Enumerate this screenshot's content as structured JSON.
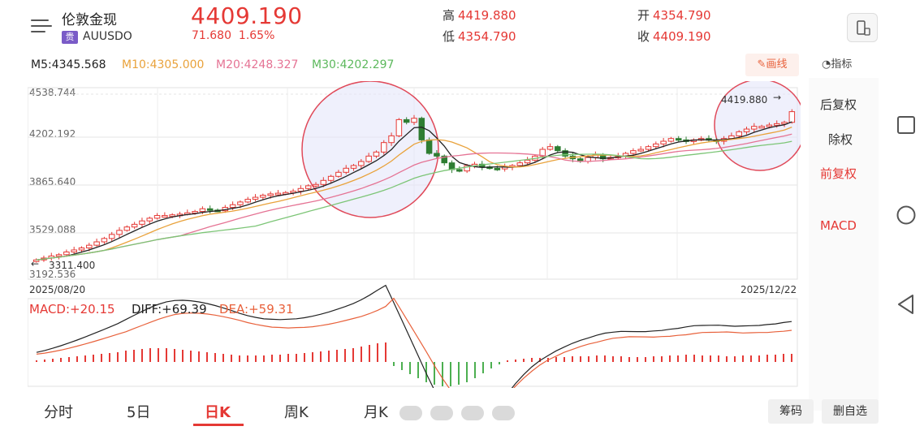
{
  "header": {
    "title": "伦敦金现",
    "badge": "贵",
    "code": "AUUSDO",
    "price": "4409.190",
    "change": "71.680",
    "change_pct": "1.65%",
    "high_label": "高",
    "high": "4419.880",
    "low_label": "低",
    "low": "4354.790",
    "open_label": "开",
    "open": "4354.790",
    "close_label": "收",
    "close": "4409.190"
  },
  "ma": {
    "m5": "M5:4345.568",
    "m10": "M10:4305.000",
    "m20": "M20:4248.327",
    "m30": "M30:4202.297",
    "draw_label": "画线",
    "indicator_label": "指标"
  },
  "colors": {
    "up": "#e53935",
    "down": "#2e7d32",
    "m5": "#222222",
    "m10": "#e9a23b",
    "m20": "#e57394",
    "m30": "#7cc576",
    "circle": "#e04a5a"
  },
  "side": {
    "items": [
      "后复权",
      "除权",
      "前复权",
      "MACD"
    ]
  },
  "chart_axis": {
    "y_ticks": [
      "4538.744",
      "4202.192",
      "3865.640",
      "3529.088",
      "3192.536"
    ],
    "start_date": "2025/08/20",
    "end_date": "2025/12/22",
    "low_mark": "3311.400",
    "high_mark": "4419.880"
  },
  "macd": {
    "macd": "MACD:+20.15",
    "diff": "DIFF:+69.39",
    "dea": "DEA:+59.31"
  },
  "tabs": [
    "分时",
    "5日",
    "日K",
    "周K",
    "月K"
  ],
  "buttons": {
    "chip": "筹码",
    "remove_fav": "删自选"
  },
  "chart_data": {
    "type": "candlestick",
    "y_range": [
      3192.536,
      4538.744
    ],
    "closes": [
      3311,
      3325,
      3340,
      3350,
      3370,
      3385,
      3400,
      3420,
      3445,
      3470,
      3500,
      3530,
      3555,
      3575,
      3600,
      3620,
      3640,
      3640,
      3645,
      3650,
      3660,
      3670,
      3690,
      3680,
      3675,
      3700,
      3720,
      3740,
      3760,
      3775,
      3790,
      3800,
      3805,
      3810,
      3820,
      3840,
      3860,
      3870,
      3900,
      3930,
      3960,
      3990,
      4010,
      4040,
      4080,
      4110,
      4180,
      4230,
      4350,
      4330,
      4360,
      4200,
      4100,
      4080,
      4030,
      3980,
      3970,
      4010,
      4020,
      4000,
      3990,
      3985,
      4000,
      4010,
      4030,
      4050,
      4080,
      4130,
      4150,
      4120,
      4080,
      4060,
      4040,
      4070,
      4090,
      4060,
      4070,
      4080,
      4100,
      4120,
      4130,
      4150,
      4170,
      4190,
      4210,
      4200,
      4190,
      4200,
      4210,
      4200,
      4190,
      4210,
      4230,
      4260,
      4280,
      4300,
      4300,
      4310,
      4320,
      4330,
      4409
    ],
    "macd_hist": [
      2,
      3,
      4,
      5,
      6,
      7,
      8,
      9,
      10,
      11,
      12,
      14,
      15,
      16,
      17,
      17,
      17,
      16,
      15,
      14,
      13,
      12,
      11,
      10,
      9,
      8,
      8,
      8,
      8,
      9,
      9,
      10,
      10,
      11,
      12,
      13,
      14,
      15,
      16,
      17,
      19,
      21,
      23,
      24,
      -5,
      -10,
      -15,
      -20,
      -25,
      -28,
      -30,
      -30,
      -28,
      -25,
      -20,
      -14,
      -8,
      -3,
      2,
      3,
      4,
      5,
      5,
      5,
      6,
      6,
      7,
      7,
      7,
      8,
      8,
      7,
      7,
      6,
      6,
      6,
      7,
      7,
      8,
      8,
      9,
      9,
      8,
      8,
      8,
      7,
      7,
      8,
      8,
      8,
      9,
      9,
      10,
      10
    ]
  }
}
